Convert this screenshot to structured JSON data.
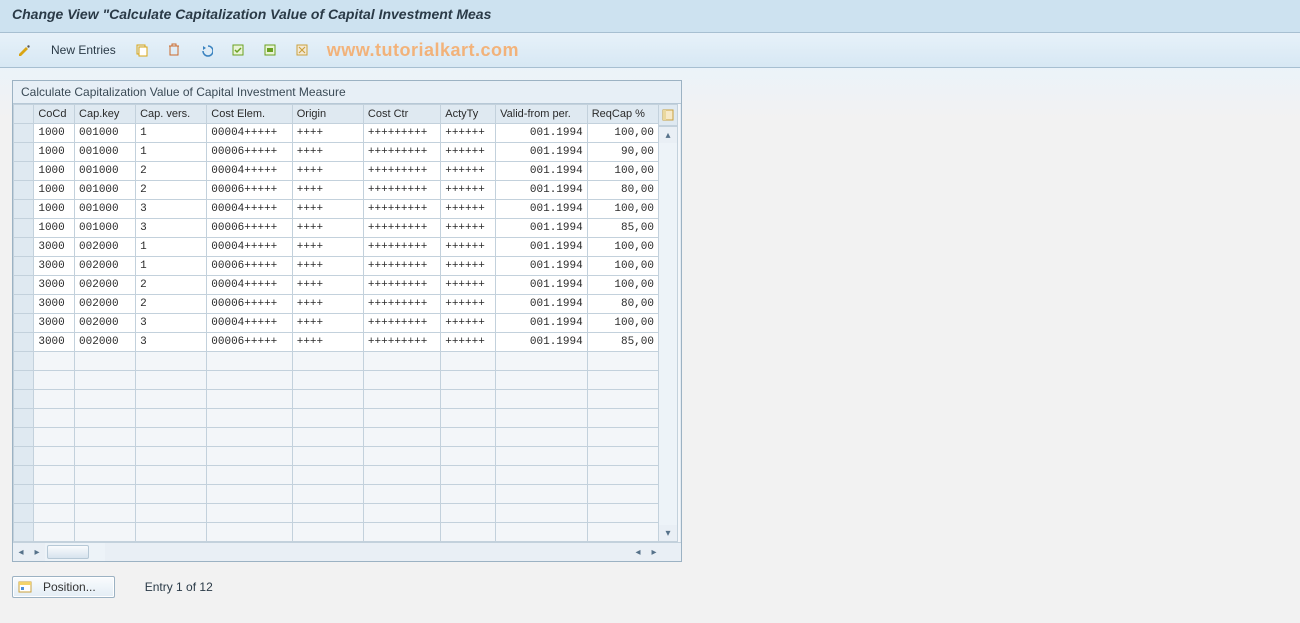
{
  "title": "Change View \"Calculate Capitalization Value of Capital Investment Meas",
  "watermark": "www.tutorialkart.com",
  "toolbar": {
    "new_entries_label": "New Entries"
  },
  "panel": {
    "title": "Calculate Capitalization Value of Capital Investment Measure"
  },
  "columns": {
    "cocd": "CoCd",
    "capkey": "Cap.key",
    "capvers": "Cap. vers.",
    "costelem": "Cost Elem.",
    "origin": "Origin",
    "costctr": "Cost Ctr",
    "actyty": "ActyTy",
    "validfrom": "Valid-from per.",
    "reqcap": "ReqCap %"
  },
  "rows": [
    {
      "cocd": "1000",
      "capkey": "001000",
      "capvers": "1",
      "costelem": "00004+++++",
      "origin": "++++",
      "costctr": "+++++++++",
      "actyty": "++++++",
      "validfrom": "001.1994",
      "reqcap": "100,00"
    },
    {
      "cocd": "1000",
      "capkey": "001000",
      "capvers": "1",
      "costelem": "00006+++++",
      "origin": "++++",
      "costctr": "+++++++++",
      "actyty": "++++++",
      "validfrom": "001.1994",
      "reqcap": "90,00"
    },
    {
      "cocd": "1000",
      "capkey": "001000",
      "capvers": "2",
      "costelem": "00004+++++",
      "origin": "++++",
      "costctr": "+++++++++",
      "actyty": "++++++",
      "validfrom": "001.1994",
      "reqcap": "100,00"
    },
    {
      "cocd": "1000",
      "capkey": "001000",
      "capvers": "2",
      "costelem": "00006+++++",
      "origin": "++++",
      "costctr": "+++++++++",
      "actyty": "++++++",
      "validfrom": "001.1994",
      "reqcap": "80,00"
    },
    {
      "cocd": "1000",
      "capkey": "001000",
      "capvers": "3",
      "costelem": "00004+++++",
      "origin": "++++",
      "costctr": "+++++++++",
      "actyty": "++++++",
      "validfrom": "001.1994",
      "reqcap": "100,00"
    },
    {
      "cocd": "1000",
      "capkey": "001000",
      "capvers": "3",
      "costelem": "00006+++++",
      "origin": "++++",
      "costctr": "+++++++++",
      "actyty": "++++++",
      "validfrom": "001.1994",
      "reqcap": "85,00"
    },
    {
      "cocd": "3000",
      "capkey": "002000",
      "capvers": "1",
      "costelem": "00004+++++",
      "origin": "++++",
      "costctr": "+++++++++",
      "actyty": "++++++",
      "validfrom": "001.1994",
      "reqcap": "100,00"
    },
    {
      "cocd": "3000",
      "capkey": "002000",
      "capvers": "1",
      "costelem": "00006+++++",
      "origin": "++++",
      "costctr": "+++++++++",
      "actyty": "++++++",
      "validfrom": "001.1994",
      "reqcap": "100,00"
    },
    {
      "cocd": "3000",
      "capkey": "002000",
      "capvers": "2",
      "costelem": "00004+++++",
      "origin": "++++",
      "costctr": "+++++++++",
      "actyty": "++++++",
      "validfrom": "001.1994",
      "reqcap": "100,00"
    },
    {
      "cocd": "3000",
      "capkey": "002000",
      "capvers": "2",
      "costelem": "00006+++++",
      "origin": "++++",
      "costctr": "+++++++++",
      "actyty": "++++++",
      "validfrom": "001.1994",
      "reqcap": "80,00"
    },
    {
      "cocd": "3000",
      "capkey": "002000",
      "capvers": "3",
      "costelem": "00004+++++",
      "origin": "++++",
      "costctr": "+++++++++",
      "actyty": "++++++",
      "validfrom": "001.1994",
      "reqcap": "100,00"
    },
    {
      "cocd": "3000",
      "capkey": "002000",
      "capvers": "3",
      "costelem": "00006+++++",
      "origin": "++++",
      "costctr": "+++++++++",
      "actyty": "++++++",
      "validfrom": "001.1994",
      "reqcap": "85,00"
    }
  ],
  "empty_rows": 10,
  "footer": {
    "position_label": "Position...",
    "entry_text": "Entry 1 of 12"
  }
}
